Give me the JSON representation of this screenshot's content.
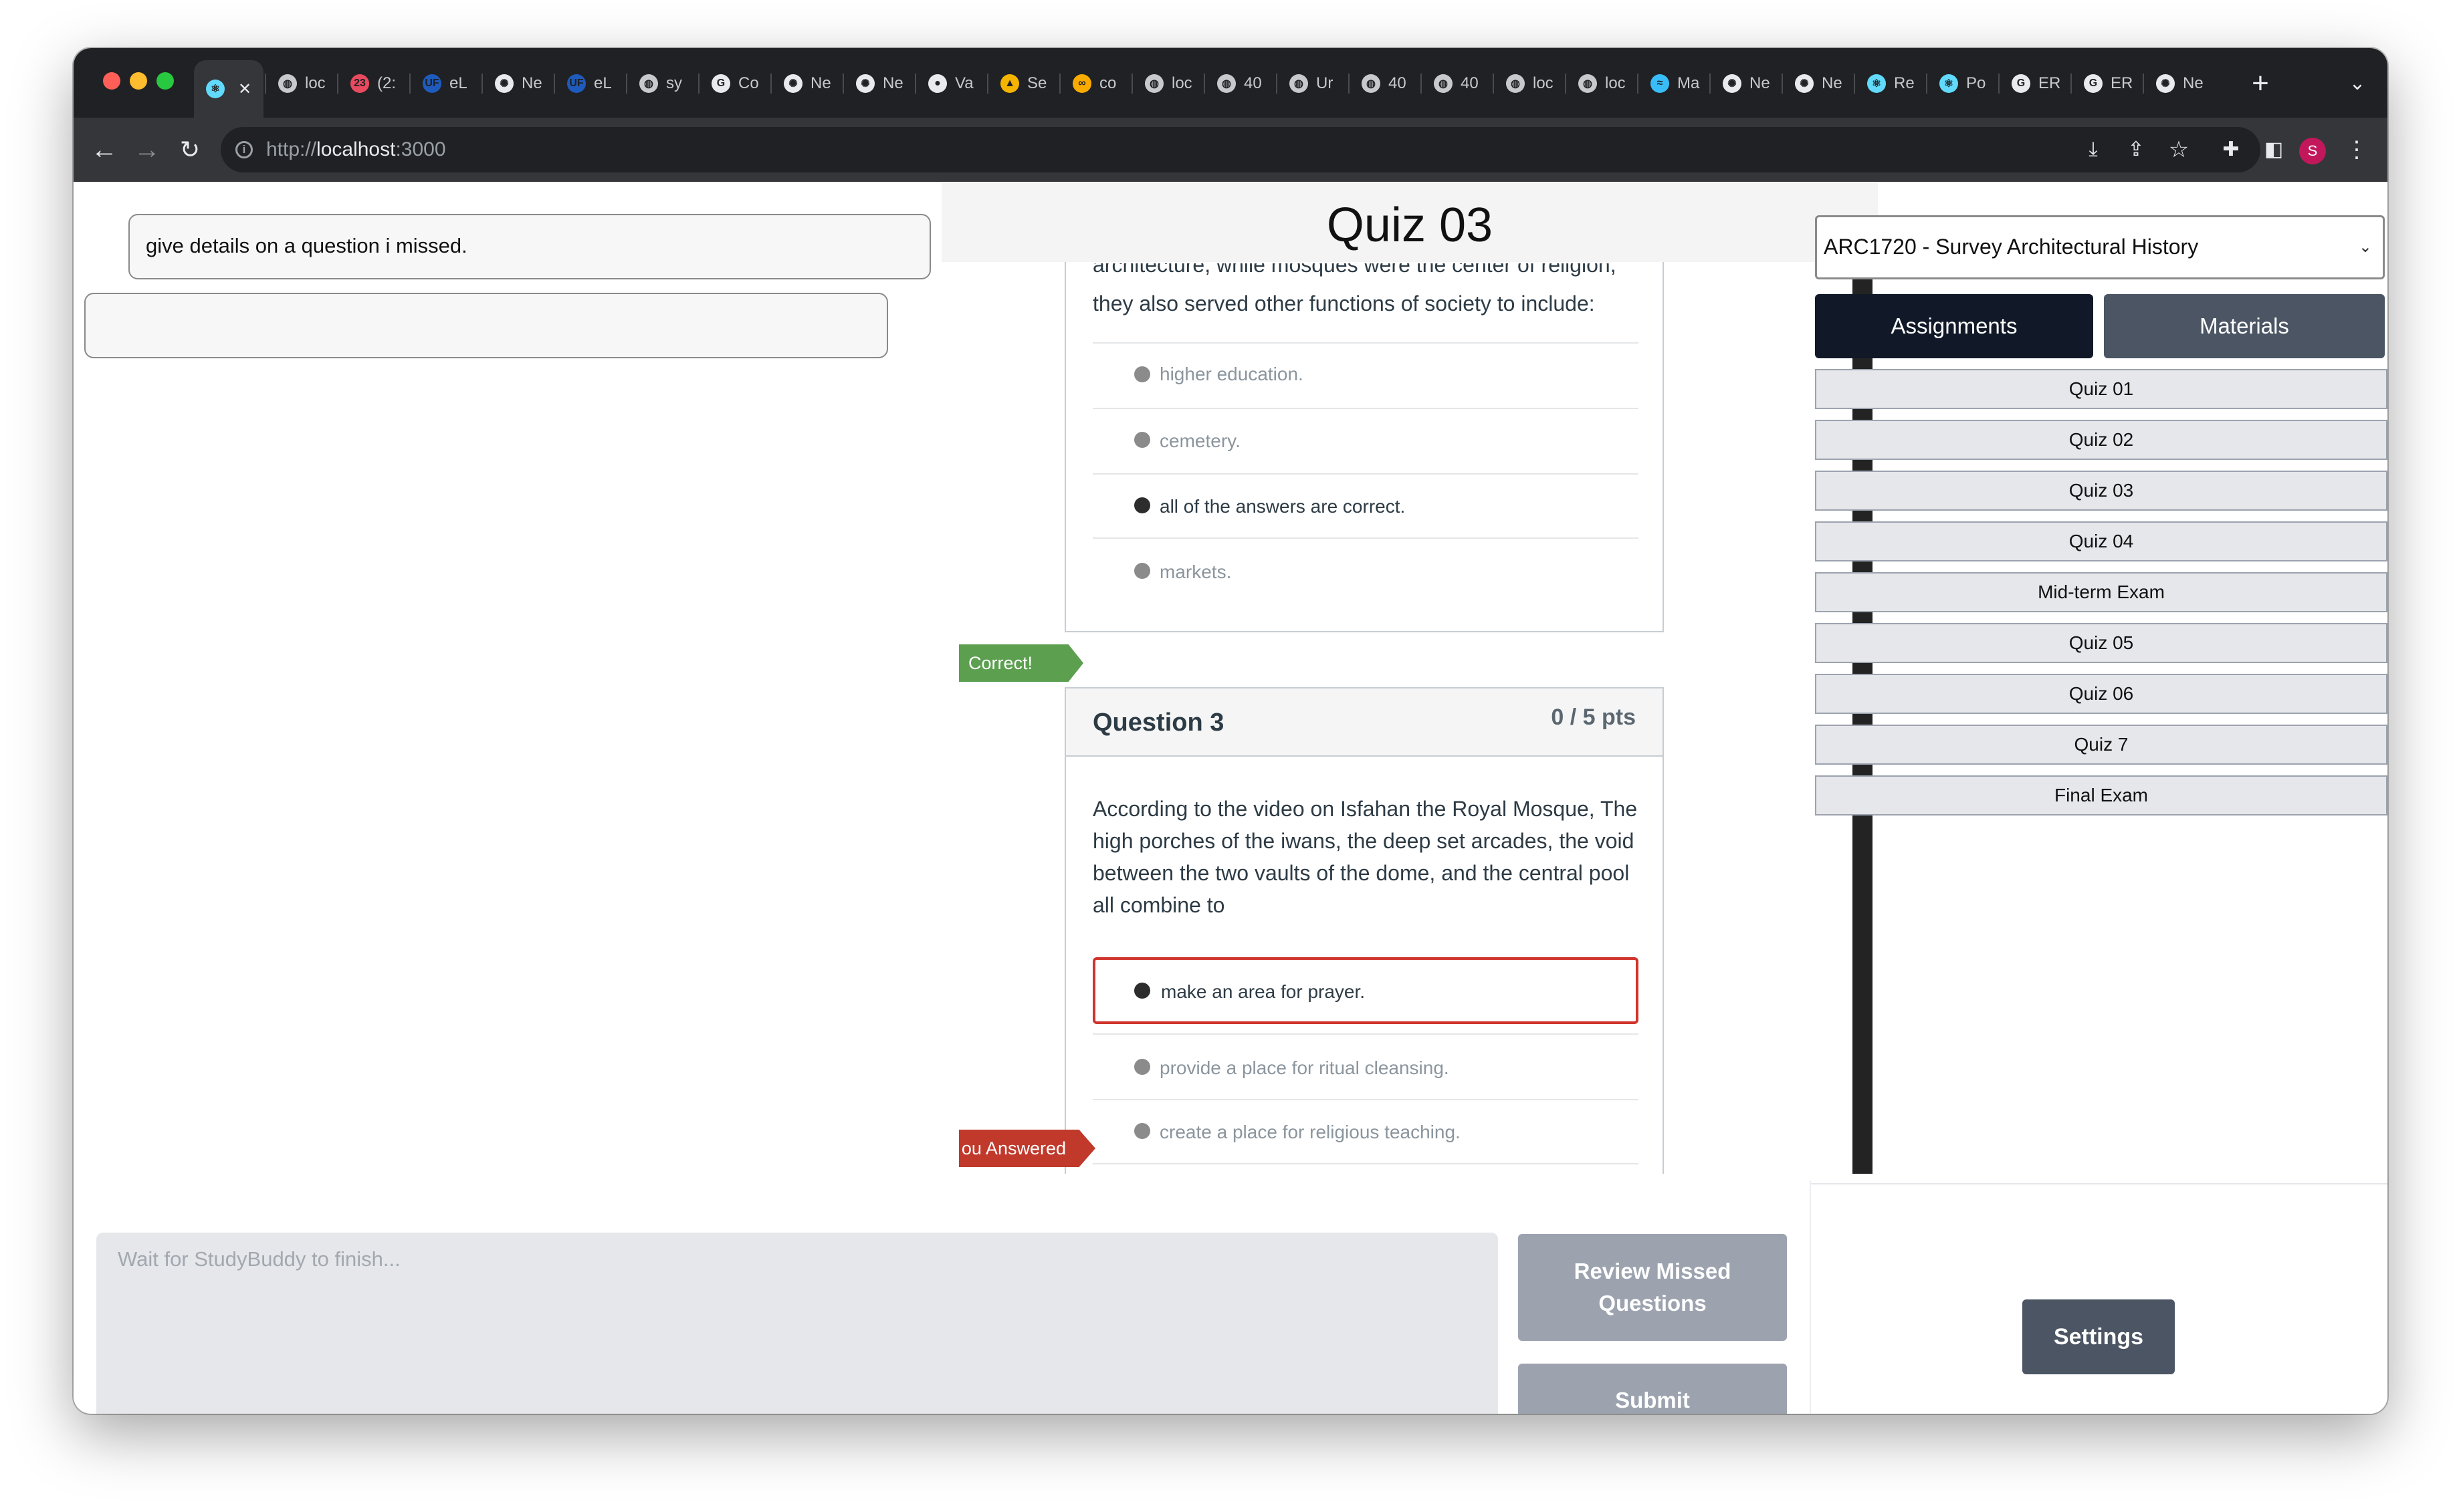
{
  "browser": {
    "tabs": [
      {
        "label": "",
        "icon": "react-icon",
        "color": "#61dafb",
        "glyph": "⚛"
      },
      {
        "label": "loc",
        "icon": "globe-icon",
        "color": "#c8c9cc",
        "glyph": "◍"
      },
      {
        "label": "(2:",
        "icon": "calendar-icon",
        "color": "#e84a5f",
        "glyph": "23"
      },
      {
        "label": "eL",
        "icon": "uf-icon",
        "color": "#1e5bbd",
        "glyph": "UF"
      },
      {
        "label": "Ne",
        "icon": "chatgpt-icon",
        "color": "#e8eaed",
        "glyph": "✺"
      },
      {
        "label": "eL",
        "icon": "uf-icon",
        "color": "#1e5bbd",
        "glyph": "UF"
      },
      {
        "label": "sy",
        "icon": "globe-icon",
        "color": "#c8c9cc",
        "glyph": "◍"
      },
      {
        "label": "Co",
        "icon": "google-icon",
        "color": "#e8eaed",
        "glyph": "G"
      },
      {
        "label": "Ne",
        "icon": "chatgpt-icon",
        "color": "#e8eaed",
        "glyph": "✺"
      },
      {
        "label": "Ne",
        "icon": "chatgpt-icon",
        "color": "#e8eaed",
        "glyph": "✺"
      },
      {
        "label": "Va",
        "icon": "github-icon",
        "color": "#e8eaed",
        "glyph": "●"
      },
      {
        "label": "Se",
        "icon": "drive-icon",
        "color": "#f4b400",
        "glyph": "▲"
      },
      {
        "label": "co",
        "icon": "colab-icon",
        "color": "#f9ab00",
        "glyph": "∞"
      },
      {
        "label": "loc",
        "icon": "globe-icon",
        "color": "#c8c9cc",
        "glyph": "◍"
      },
      {
        "label": "40",
        "icon": "globe-icon",
        "color": "#c8c9cc",
        "glyph": "◍"
      },
      {
        "label": "Ur",
        "icon": "globe-icon",
        "color": "#c8c9cc",
        "glyph": "◍"
      },
      {
        "label": "40",
        "icon": "globe-icon",
        "color": "#c8c9cc",
        "glyph": "◍"
      },
      {
        "label": "40",
        "icon": "globe-icon",
        "color": "#c8c9cc",
        "glyph": "◍"
      },
      {
        "label": "loc",
        "icon": "globe-icon",
        "color": "#c8c9cc",
        "glyph": "◍"
      },
      {
        "label": "loc",
        "icon": "globe-icon",
        "color": "#c8c9cc",
        "glyph": "◍"
      },
      {
        "label": "Ma",
        "icon": "tailwind-icon",
        "color": "#38bdf8",
        "glyph": "≈"
      },
      {
        "label": "Ne",
        "icon": "chatgpt-icon",
        "color": "#e8eaed",
        "glyph": "✺"
      },
      {
        "label": "Ne",
        "icon": "chatgpt-icon",
        "color": "#e8eaed",
        "glyph": "✺"
      },
      {
        "label": "Re",
        "icon": "react-icon",
        "color": "#61dafb",
        "glyph": "⚛"
      },
      {
        "label": "Po",
        "icon": "react-icon",
        "color": "#61dafb",
        "glyph": "⚛"
      },
      {
        "label": "ER",
        "icon": "google-icon",
        "color": "#e8eaed",
        "glyph": "G"
      },
      {
        "label": "ER",
        "icon": "google-icon",
        "color": "#e8eaed",
        "glyph": "G"
      },
      {
        "label": "Ne",
        "icon": "chatgpt-icon",
        "color": "#e8eaed",
        "glyph": "✺"
      }
    ],
    "url_prefix": "http://",
    "url_host": "localhost",
    "url_port": ":3000",
    "avatar_letter": "S"
  },
  "chat": {
    "messages": [
      "give details on a question i missed.",
      ""
    ]
  },
  "quiz": {
    "title": "Quiz 03",
    "question2": {
      "text_partial_line1": "architecture, while mosques were the center of religion,",
      "text_line2": "they also served other functions of society to include:",
      "answers": [
        "higher education.",
        "cemetery.",
        "all of the answers are correct.",
        "markets."
      ],
      "flag": "Correct!"
    },
    "question3": {
      "title": "Question 3",
      "points": "0 / 5 pts",
      "text_lines": [
        "According to the video on Isfahan the Royal Mosque, The",
        "high porches of the iwans, the deep set arcades, the void",
        "between the two vaults of the dome, and the central pool",
        "all combine to"
      ],
      "answers": [
        "make an area for prayer.",
        "provide a place for ritual cleansing.",
        "create a place for religious teaching."
      ],
      "flag": "ou Answered"
    }
  },
  "sidebar": {
    "course": "ARC1720 - Survey Architectural History",
    "tabs": {
      "assignments": "Assignments",
      "materials": "Materials"
    },
    "items": [
      "Quiz 01",
      "Quiz 02",
      "Quiz 03",
      "Quiz 04",
      "Mid-term Exam",
      "Quiz 05",
      "Quiz 06",
      "Quiz 7",
      "Final Exam"
    ]
  },
  "composer": {
    "placeholder": "Wait for StudyBuddy to finish...",
    "review_label": "Review Missed Questions",
    "submit_label": "Submit",
    "settings_label": "Settings"
  }
}
